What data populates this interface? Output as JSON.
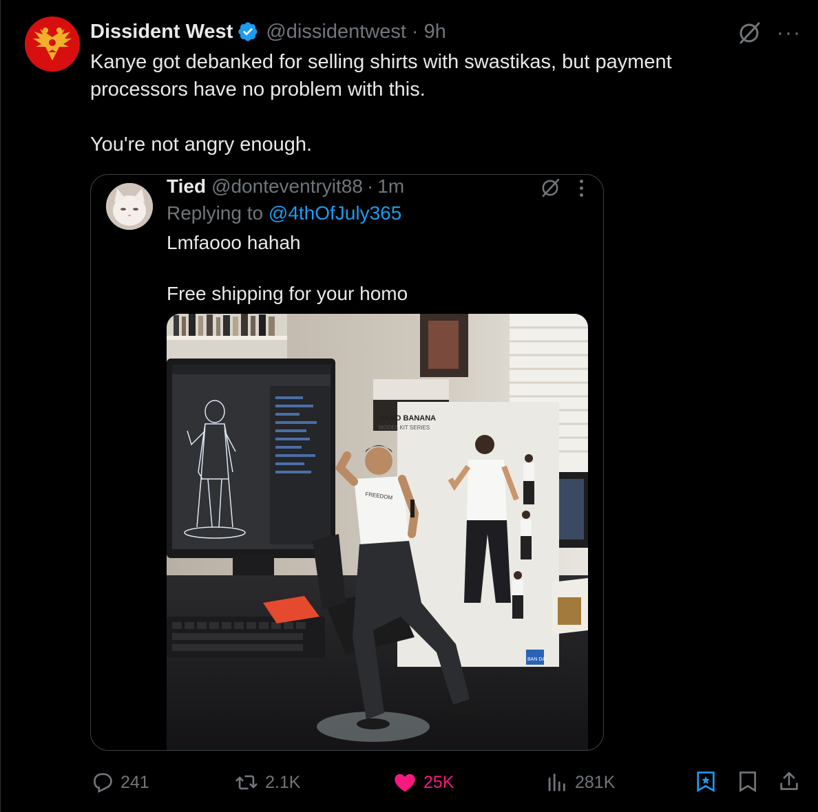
{
  "tweet": {
    "author_name": "Dissident West",
    "author_handle": "@dissidentwest",
    "separator": "·",
    "time": "9h",
    "text_line1": "Kanye got debanked for selling shirts with swastikas, but payment processors have no problem with this.",
    "text_line2": "You're not angry enough."
  },
  "quote": {
    "author_name": "Tied",
    "author_handle": "@donteventryit88",
    "separator": "·",
    "time": "1m",
    "replying_prefix": "Replying to ",
    "replying_to": "@4thOfJuly365",
    "text_line1": "Lmfaooo hahah",
    "text_line2": "Free shipping for your homo",
    "image_box_title": "NANO BANANA",
    "image_box_subtitle": "MODEL KIT SERIES",
    "image_shirt_text": "FREEDOM",
    "image_brand": "BAN DAI"
  },
  "actions": {
    "replies": "241",
    "reposts": "2.1K",
    "likes": "25K",
    "views": "281K"
  },
  "icons": {
    "reply": "reply-icon",
    "repost": "repost-icon",
    "like": "heart-icon",
    "views": "views-icon",
    "grok": "grok-icon",
    "more": "more-icon",
    "bookmark": "bookmark-icon",
    "share": "share-icon",
    "verified": "verified-badge-icon"
  },
  "colors": {
    "background": "#000000",
    "text": "#e7e9ea",
    "muted": "#71767b",
    "accent": "#1d9bf0",
    "like": "#f91880",
    "avatar": "#d7100f"
  }
}
